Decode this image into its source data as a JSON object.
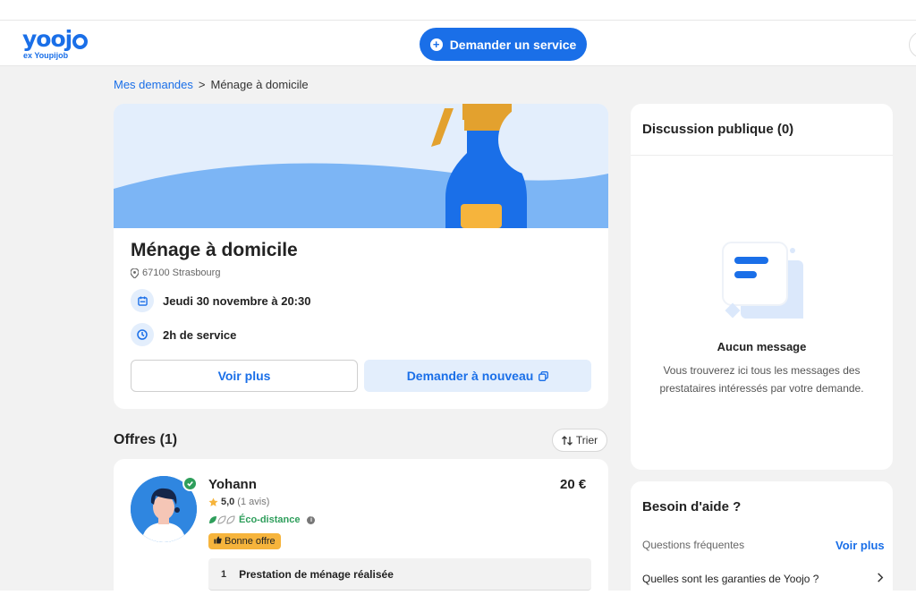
{
  "header": {
    "logo_text": "yooj",
    "logo_sub": "ex Youpijob",
    "request_button": "Demander un service"
  },
  "breadcrumb": {
    "parent": "Mes demandes",
    "separator": ">",
    "current": "Ménage à domicile"
  },
  "service": {
    "title": "Ménage à domicile",
    "location": "67100 Strasbourg",
    "date": "Jeudi 30 novembre à 20:30",
    "duration": "2h de service",
    "see_more_label": "Voir plus",
    "request_again_label": "Demander à nouveau"
  },
  "offers": {
    "title": "Offres (1)",
    "sort_label": "Trier",
    "items": [
      {
        "name": "Yohann",
        "price": "20 €",
        "rating": "5,0",
        "reviews": "(1 avis)",
        "eco_label": "Éco-distance",
        "badge": "Bonne offre",
        "task_number": "1",
        "task_label": "Prestation de ménage réalisée"
      }
    ]
  },
  "discussion": {
    "title": "Discussion publique (0)",
    "empty_title": "Aucun message",
    "empty_desc": "Vous trouverez ici tous les messages des prestataires intéressés par votre demande."
  },
  "help": {
    "title": "Besoin d'aide ?",
    "faq_label": "Questions fréquentes",
    "see_more": "Voir plus",
    "faq_items": [
      "Quelles sont les garanties de Yoojo ?"
    ]
  },
  "colors": {
    "primary": "#1a6fe8",
    "light_blue": "#e3eefc",
    "eco_green": "#2e9e5b",
    "badge_orange": "#f6b43c",
    "background": "#f2f2f2"
  }
}
